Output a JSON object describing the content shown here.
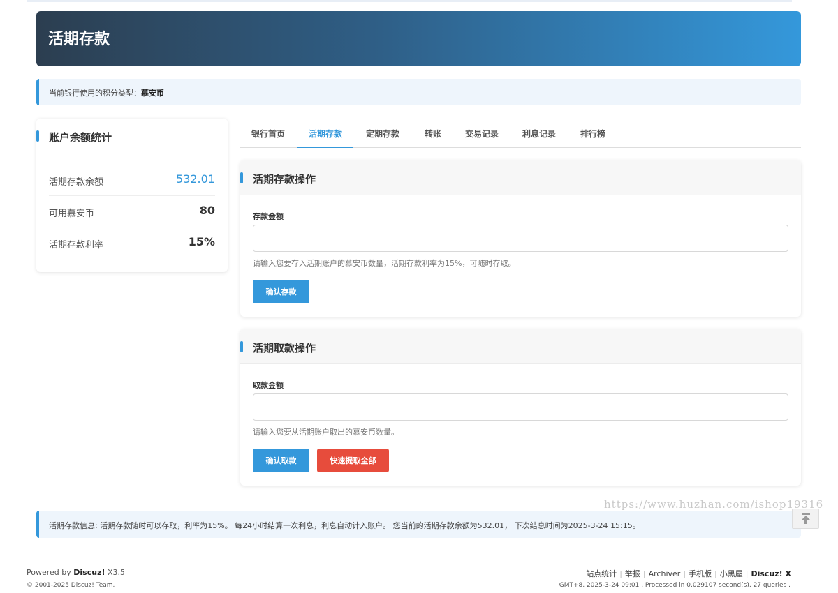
{
  "page": {
    "title": "活期存款"
  },
  "notice_top": {
    "label": "当前银行使用的积分类型：",
    "currency": "慕安币"
  },
  "stats": {
    "title": "账户余额统计",
    "rows": [
      {
        "label": "活期存款余额",
        "value": "532.01"
      },
      {
        "label": "可用慕安币",
        "value": "80"
      },
      {
        "label": "活期存款利率",
        "value": "15%"
      }
    ]
  },
  "tabs": [
    {
      "label": "银行首页",
      "active": false
    },
    {
      "label": "活期存款",
      "active": true
    },
    {
      "label": "定期存款",
      "active": false
    },
    {
      "label": "转账",
      "active": false
    },
    {
      "label": "交易记录",
      "active": false
    },
    {
      "label": "利息记录",
      "active": false
    },
    {
      "label": "排行榜",
      "active": false
    }
  ],
  "deposit": {
    "title": "活期存款操作",
    "field_label": "存款金额",
    "value": "",
    "hint": "请输入您要存入活期账户的慕安币数量，活期存款利率为15%，可随时存取。",
    "confirm_label": "确认存款"
  },
  "withdraw": {
    "title": "活期取款操作",
    "field_label": "取款金额",
    "value": "",
    "hint": "请输入您要从活期账户取出的慕安币数量。",
    "confirm_label": "确认取款",
    "withdraw_all_label": "快速提取全部"
  },
  "notice_bottom": {
    "text": "活期存款信息: 活期存款随时可以存取，利率为15%。 每24小时结算一次利息，利息自动计入账户。 您当前的活期存款余额为532.01， 下次结息时间为2025-3-24 15:15。"
  },
  "watermark": "https://www.huzhan.com/ishop19316",
  "footer": {
    "powered_prefix": "Powered by ",
    "powered_brand": "Discuz!",
    "powered_version": " X3.5",
    "copyright": "© 2001-2025 Discuz! Team.",
    "links": [
      "站点统计",
      "举报",
      "Archiver",
      "手机版",
      "小黑屋"
    ],
    "brand": "Discuz! X",
    "gmt": "GMT+8, 2025-3-24 09:01 , Processed in 0.029107 second(s), 27 queries ."
  },
  "icons": {
    "back_to_top": "arrow-up-icon"
  },
  "colors": {
    "accent": "#3498db",
    "danger": "#e74c3c",
    "banner_start": "#2c3e50"
  }
}
